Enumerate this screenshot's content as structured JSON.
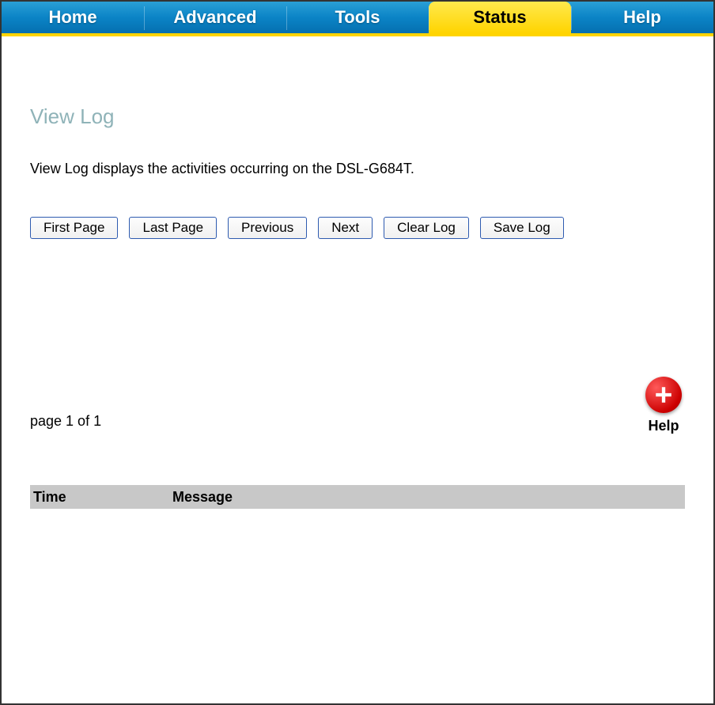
{
  "nav": {
    "tabs": [
      {
        "label": "Home",
        "active": false
      },
      {
        "label": "Advanced",
        "active": false
      },
      {
        "label": "Tools",
        "active": false
      },
      {
        "label": "Status",
        "active": true
      },
      {
        "label": "Help",
        "active": false
      }
    ]
  },
  "page": {
    "title": "View Log",
    "description": "View Log displays the activities occurring on the DSL-G684T.",
    "page_indicator": "page 1 of 1"
  },
  "buttons": {
    "first_page": "First Page",
    "last_page": "Last Page",
    "previous": "Previous",
    "next": "Next",
    "clear_log": "Clear Log",
    "save_log": "Save Log"
  },
  "help_widget": {
    "label": "Help"
  },
  "table": {
    "columns": {
      "time": "Time",
      "message": "Message"
    },
    "rows": []
  }
}
